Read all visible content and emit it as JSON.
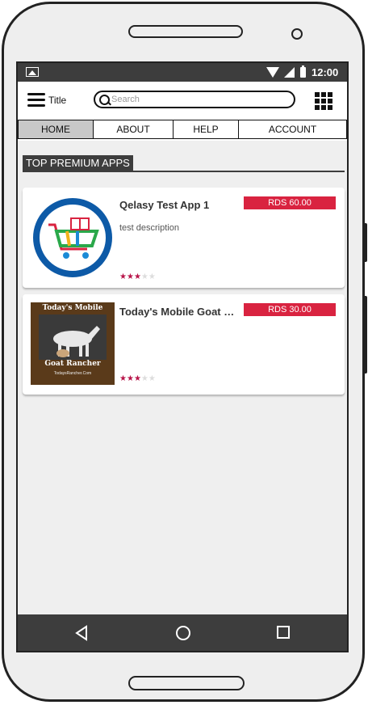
{
  "status_bar": {
    "time": "12:00"
  },
  "app_bar": {
    "title": "Title",
    "search_placeholder": "Search"
  },
  "tabs": [
    {
      "label": "HOME",
      "active": true
    },
    {
      "label": "ABOUT",
      "active": false
    },
    {
      "label": "HELP",
      "active": false
    },
    {
      "label": "ACCOUNT",
      "active": false
    }
  ],
  "section": {
    "title": "TOP PREMIUM APPS"
  },
  "apps": [
    {
      "title": "Qelasy Test App 1",
      "description": "test description",
      "price": "RDS 60.00",
      "rating": 3,
      "rating_max": 5
    },
    {
      "title": "Today's Mobile Goat Rancher",
      "description": "",
      "price": "RDS 30.00",
      "rating": 2.5,
      "rating_max": 5,
      "image_text": {
        "top": "Today's Mobile",
        "bottom": "Goat Rancher",
        "url": "TodaysRancher.Com"
      }
    }
  ],
  "colors": {
    "price_badge": "#d92340",
    "star": "#b8154a",
    "bars": "#3d3d3d"
  }
}
